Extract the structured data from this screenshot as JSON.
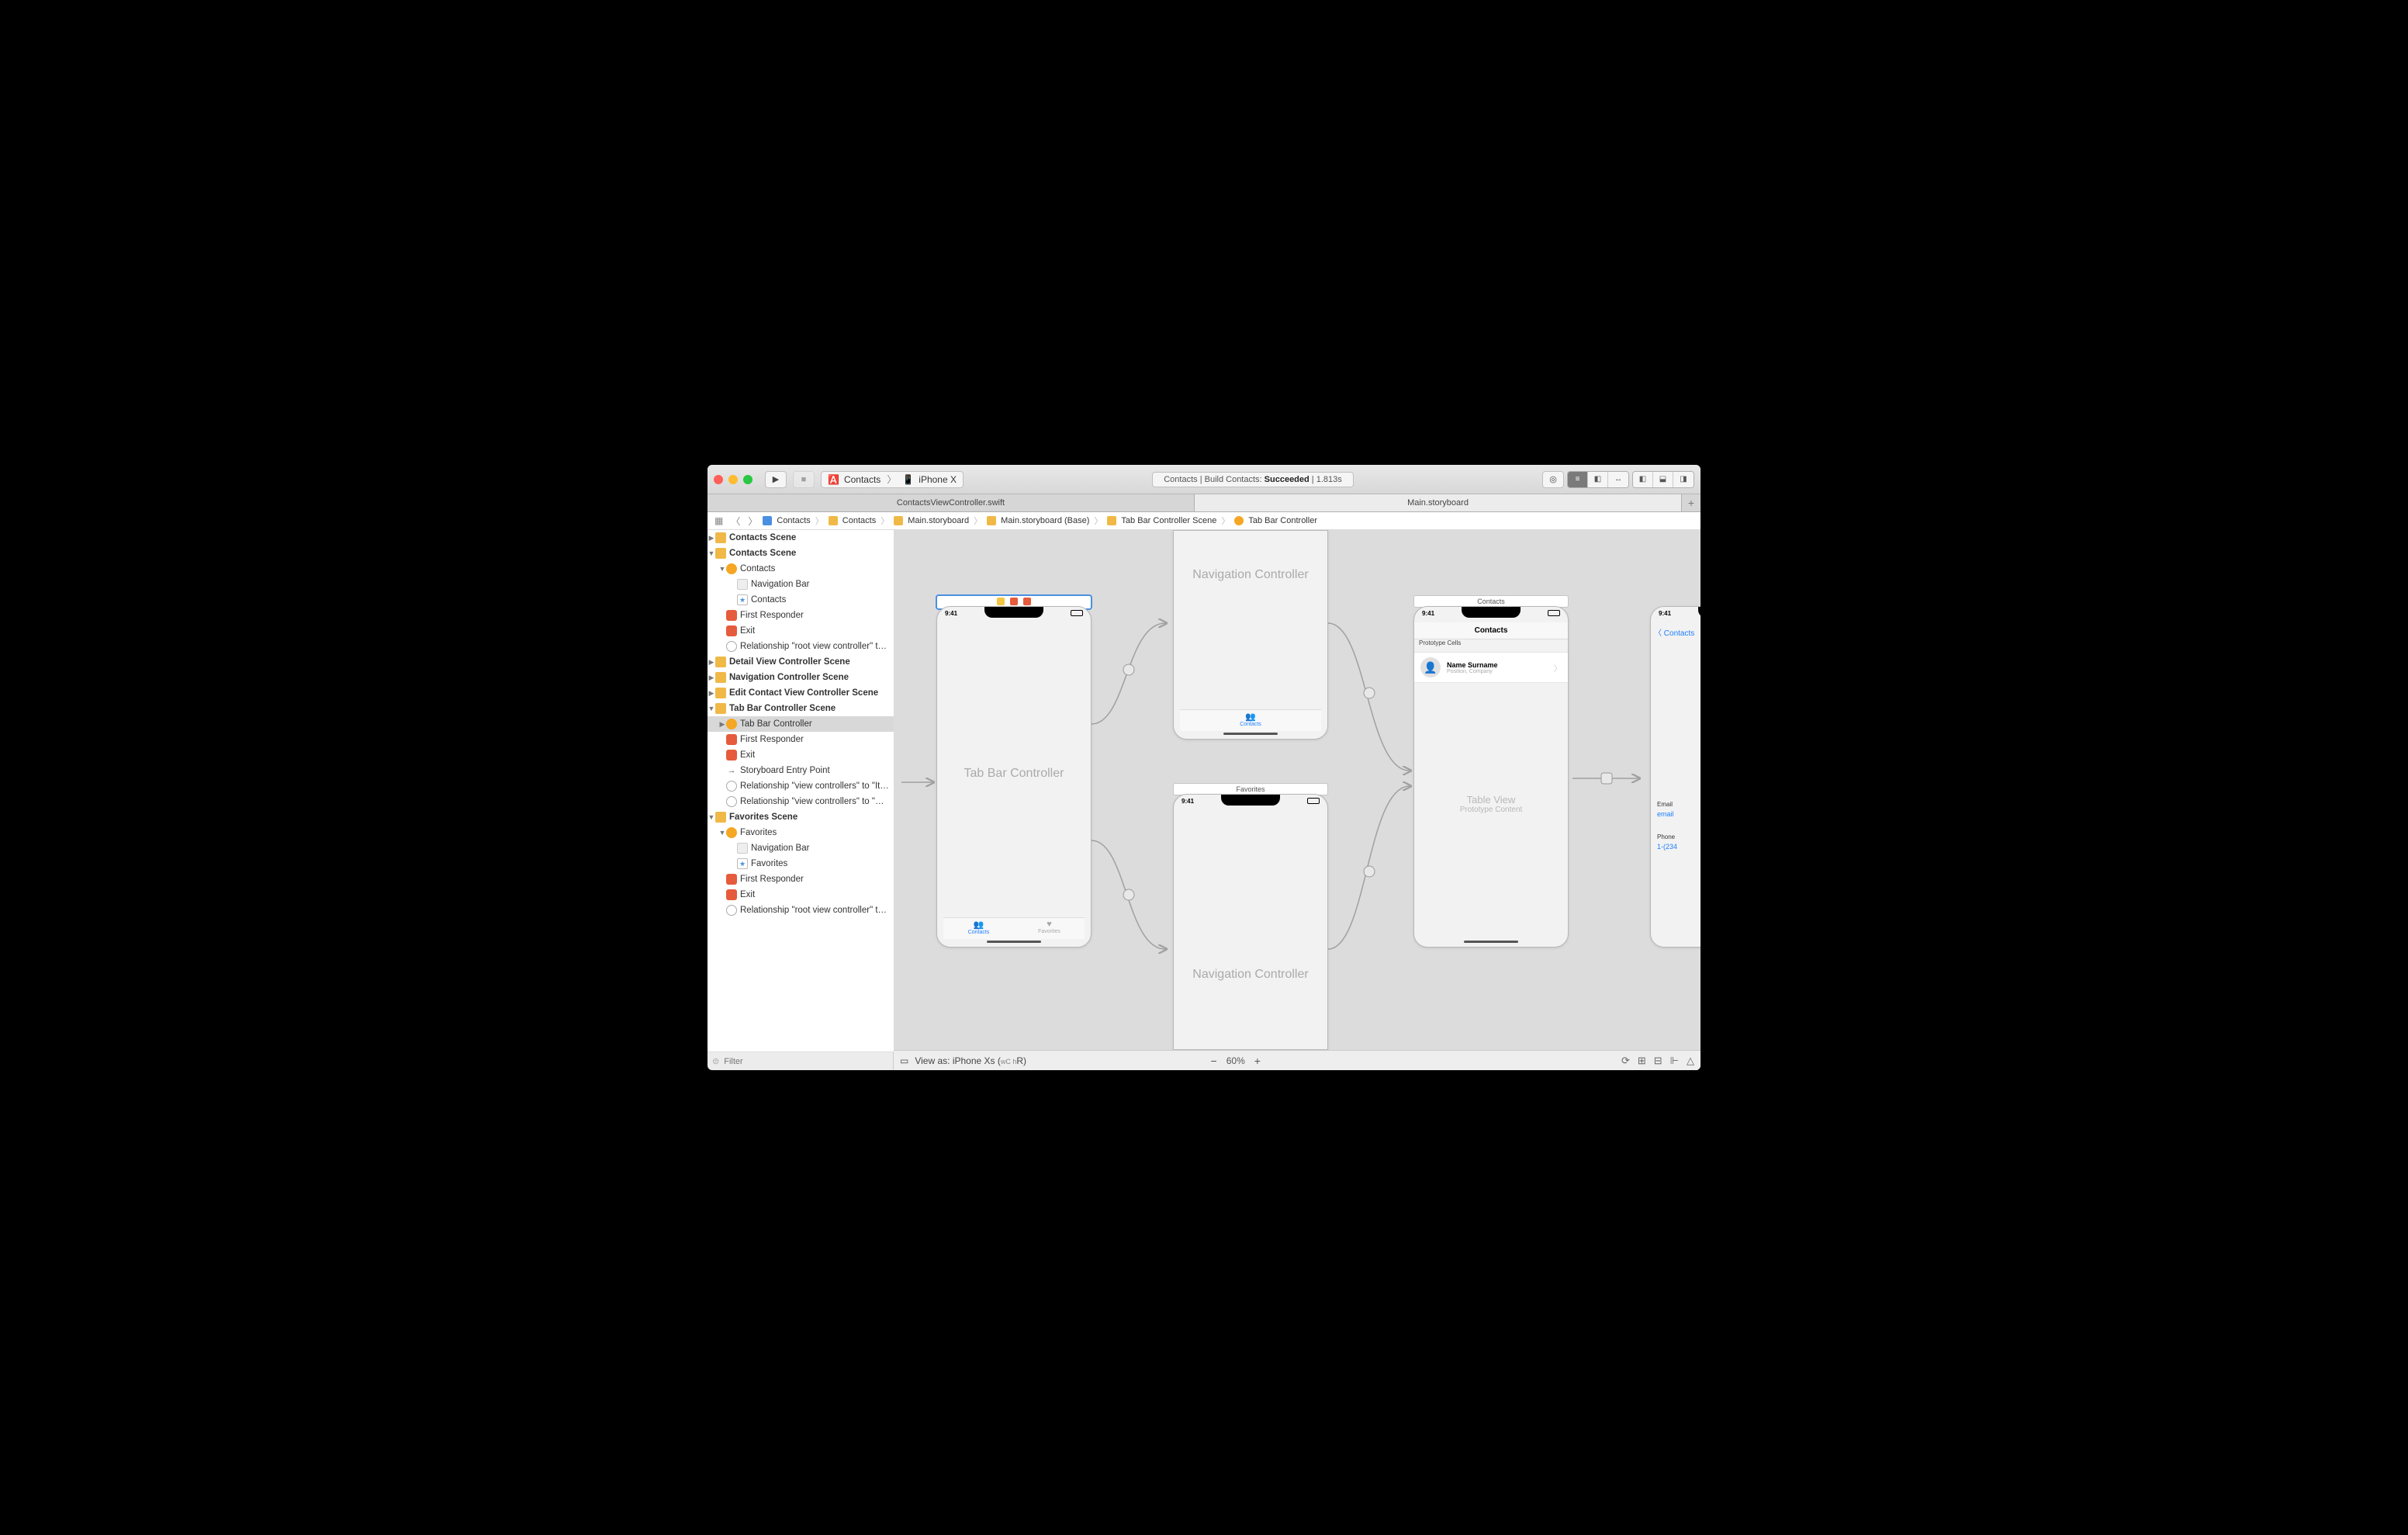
{
  "toolbar": {
    "scheme_app": "Contacts",
    "scheme_device": "iPhone X",
    "status_prefix": "Contacts | Build Contacts: ",
    "status_result": "Succeeded",
    "status_time": " | 1.813s"
  },
  "tabs": {
    "tab1": "ContactsViewController.swift",
    "tab2": "Main.storyboard"
  },
  "jumpbar": {
    "items": [
      "Contacts",
      "Contacts",
      "Main.storyboard",
      "Main.storyboard (Base)",
      "Tab Bar Controller Scene",
      "Tab Bar Controller"
    ]
  },
  "outline": {
    "scenes": [
      {
        "label": "Contacts Scene",
        "expanded": false
      },
      {
        "label": "Contacts Scene",
        "expanded": true,
        "children": [
          {
            "label": "Contacts",
            "icon": "vc",
            "expanded": true,
            "children": [
              {
                "label": "Navigation Bar",
                "icon": "nav"
              },
              {
                "label": "Contacts",
                "icon": "tv"
              }
            ]
          },
          {
            "label": "First Responder",
            "icon": "fr"
          },
          {
            "label": "Exit",
            "icon": "exit"
          },
          {
            "label": "Relationship \"root view controller\" t…",
            "icon": "rel"
          }
        ]
      },
      {
        "label": "Detail View Controller Scene",
        "expanded": false
      },
      {
        "label": "Navigation Controller Scene",
        "expanded": false
      },
      {
        "label": "Edit Contact View Controller Scene",
        "expanded": false
      },
      {
        "label": "Tab Bar Controller Scene",
        "expanded": true,
        "children": [
          {
            "label": "Tab Bar Controller",
            "icon": "vc",
            "selected": true,
            "expanded": false
          },
          {
            "label": "First Responder",
            "icon": "fr"
          },
          {
            "label": "Exit",
            "icon": "exit"
          },
          {
            "label": "Storyboard Entry Point",
            "icon": "sep"
          },
          {
            "label": "Relationship \"view controllers\" to \"It…",
            "icon": "rel"
          },
          {
            "label": "Relationship \"view controllers\" to \"…",
            "icon": "rel"
          }
        ]
      },
      {
        "label": "Favorites Scene",
        "expanded": true,
        "children": [
          {
            "label": "Favorites",
            "icon": "vc",
            "expanded": true,
            "children": [
              {
                "label": "Navigation Bar",
                "icon": "nav"
              },
              {
                "label": "Favorites",
                "icon": "tv"
              }
            ]
          },
          {
            "label": "First Responder",
            "icon": "fr"
          },
          {
            "label": "Exit",
            "icon": "exit"
          },
          {
            "label": "Relationship \"root view controller\" t…",
            "icon": "rel"
          }
        ]
      }
    ],
    "filter_placeholder": "Filter"
  },
  "canvas": {
    "time": "9:41",
    "tabbar": {
      "title": "Tab Bar Controller",
      "tab1": "Contacts",
      "tab2": "Favorites"
    },
    "nav1": {
      "title": "Navigation Controller",
      "tab": "Contacts"
    },
    "nav2": {
      "title": "Navigation Controller",
      "label": "Favorites"
    },
    "contacts": {
      "header": "Contacts",
      "proto": "Prototype Cells",
      "name": "Name Surname",
      "position": "Position, Company",
      "tv": "Table View",
      "tvsub": "Prototype Content"
    },
    "detail": {
      "back": "Contacts",
      "email_lbl": "Email",
      "email_val": "email",
      "phone_lbl": "Phone",
      "phone_val": "1-(234"
    }
  },
  "bottombar": {
    "viewas": "View as: iPhone Xs (",
    "viewas_trail": "R)",
    "viewas_micro": "wC h",
    "zoom": "60%"
  }
}
